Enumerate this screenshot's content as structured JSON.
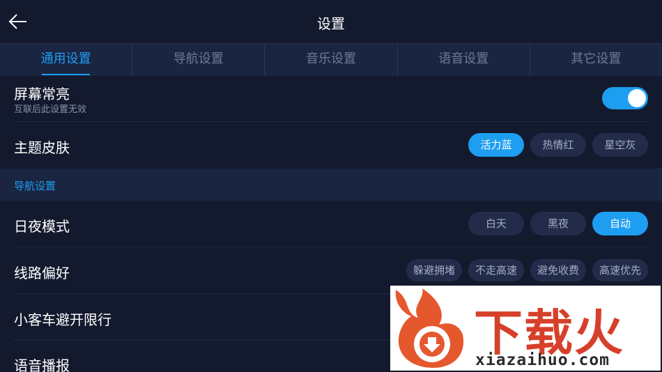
{
  "header": {
    "title": "设置",
    "back_icon": "arrow-left-icon"
  },
  "tabs": [
    {
      "label": "通用设置",
      "active": true
    },
    {
      "label": "导航设置",
      "active": false
    },
    {
      "label": "音乐设置",
      "active": false
    },
    {
      "label": "语音设置",
      "active": false
    },
    {
      "label": "其它设置",
      "active": false
    }
  ],
  "general": {
    "screen_on": {
      "label": "屏幕常亮",
      "sub": "互联后此设置无效",
      "toggle_on": true
    },
    "theme": {
      "label": "主题皮肤",
      "options": [
        "活力蓝",
        "热情红",
        "星空灰"
      ],
      "selected": "活力蓝"
    }
  },
  "nav_section": {
    "title": "导航设置",
    "day_night": {
      "label": "日夜模式",
      "options": [
        "白天",
        "黑夜",
        "自动"
      ],
      "selected": "自动"
    },
    "route_pref": {
      "label": "线路偏好",
      "options": [
        "躲避拥堵",
        "不走高速",
        "避免收费",
        "高速优先"
      ]
    },
    "car_restriction": {
      "label": "小客车避开限行"
    },
    "voice_broadcast": {
      "label": "语音播报"
    }
  },
  "watermark": {
    "logo_text": "下载火",
    "url": "xiazaihuo.com"
  },
  "colors": {
    "background": "#141a2e",
    "tab_bar": "#1a2542",
    "accent": "#1e9ef0",
    "option_bg": "#222c4a",
    "watermark_red": "#d6402a"
  }
}
